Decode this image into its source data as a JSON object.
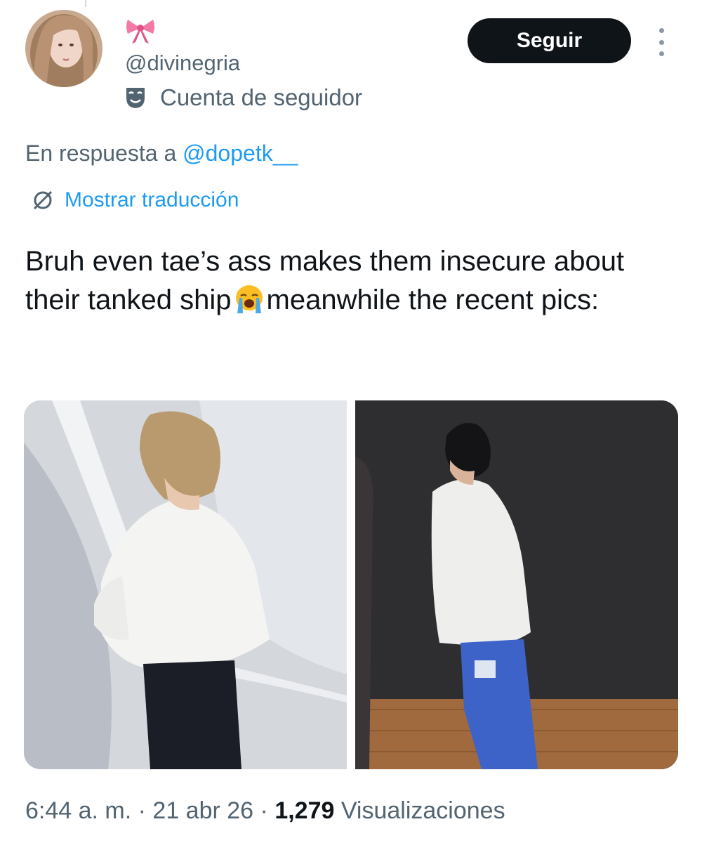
{
  "author": {
    "handle": "@divinegria",
    "badge_emoji_icon": "ribbon-bow-icon",
    "account_type_icon": "mask-icon",
    "account_type": "Cuenta de seguidor"
  },
  "actions": {
    "follow_label": "Seguir",
    "more_icon": "vertical-dots-icon"
  },
  "reply": {
    "prefix": "En respuesta a ",
    "mention": "@dopetk__"
  },
  "translate": {
    "icon": "globe-slash-icon",
    "label": "Mostrar traducción"
  },
  "tweet": {
    "text_part1": "Bruh even tae’s ass makes them insecure about their tanked ship",
    "emoji_icon": "loudly-crying-face-icon",
    "text_part2": "meanwhile the recent pics:"
  },
  "media": [
    {
      "icon": "photo-person-white-shirt-bright-room"
    },
    {
      "icon": "photo-person-white-shirt-dark-room"
    }
  ],
  "footer": {
    "time": "6:44 a. m.",
    "sep1": " · ",
    "date": "21 abr 26",
    "sep2": " · ",
    "views_count": "1,279",
    "views_label": " Visualizaciones"
  },
  "colors": {
    "accent": "#1d9bf0",
    "secondary_text": "#536471",
    "primary_text": "#0f1419",
    "button_bg": "#0f1419"
  }
}
